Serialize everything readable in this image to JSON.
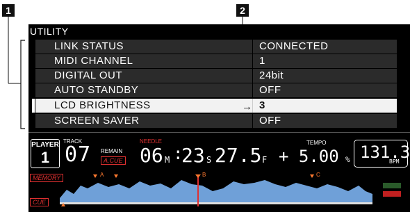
{
  "callouts": [
    "1",
    "2"
  ],
  "screen": {
    "title": "UTILITY",
    "rows": [
      {
        "label": "LINK STATUS",
        "value": "CONNECTED"
      },
      {
        "label": "MIDI CHANNEL",
        "value": "1"
      },
      {
        "label": "DIGITAL OUT",
        "value": "24bit"
      },
      {
        "label": "AUTO STANDBY",
        "value": "OFF"
      },
      {
        "label": "LCD BRIGHTNESS",
        "value": "3"
      },
      {
        "label": "SCREEN SAVER",
        "value": "OFF"
      }
    ],
    "selected_row": "LCD BRIGHTNESS"
  },
  "player": {
    "player_label": "PLAYER",
    "player_number": "1",
    "track_label": "TRACK",
    "track_number": "07",
    "remain_label": "REMAIN",
    "acue_label": "A.CUE",
    "needle_label": "NEEDLE",
    "time_minutes": "06",
    "m": "M",
    "time_seconds": "23",
    "s": "S",
    "time_frames": "27.5",
    "f": "F",
    "tempo_label": "TEMPO",
    "tempo_value": "+ 5.00",
    "percent": "%",
    "bpm_value": "131.3",
    "bpm_label": "BPM",
    "memory_label": "MEMORY",
    "cue_label": "CUE",
    "markers": [
      "A",
      "B",
      "C"
    ]
  },
  "colors": {
    "accent": "#e03030",
    "wave": "#6fa0d8",
    "selected_row_bg": "#f2f2f2"
  }
}
